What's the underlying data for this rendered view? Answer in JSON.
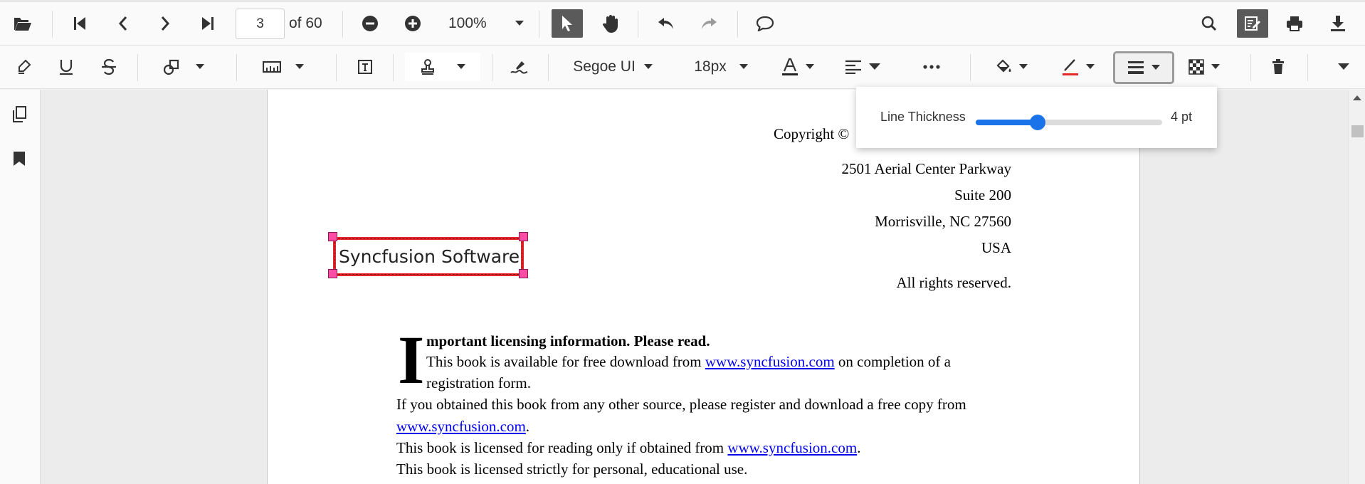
{
  "toolbar_top": {
    "current_page": "3",
    "page_count_label": "of 60",
    "zoom_value": "100%",
    "icons": [
      "folder-open-icon",
      "first-page-icon",
      "previous-page-icon",
      "next-page-icon",
      "last-page-icon",
      "zoom-out-icon",
      "zoom-in-icon",
      "chevron-down-icon",
      "pointer-icon",
      "pan-hand-icon",
      "undo-icon",
      "redo-icon",
      "comment-icon",
      "search-icon",
      "edit-annotation-icon",
      "print-icon",
      "download-icon"
    ]
  },
  "toolbar_annotation": {
    "font_family": "Segoe UI",
    "font_size": "18px",
    "icons": [
      "highlight-icon",
      "underline-icon",
      "strikethrough-icon",
      "shape-icon",
      "measure-icon",
      "free-text-icon",
      "stamp-icon",
      "signature-icon",
      "font-color-icon",
      "text-align-icon",
      "more-options-icon",
      "fill-color-icon",
      "stroke-color-icon",
      "line-thickness-icon",
      "opacity-icon",
      "delete-icon",
      "toolbar-collapse-icon"
    ]
  },
  "sidebar": {
    "icons": [
      "page-thumbnails-icon",
      "bookmarks-icon"
    ]
  },
  "line_thickness_popup": {
    "label": "Line Thickness",
    "value_label": "4 pt",
    "value": 4,
    "min": 0,
    "max": 12
  },
  "annotation": {
    "text": "Syncfusion Software",
    "stroke_color": "#e4262b"
  },
  "document": {
    "copyright": "Copyright ©",
    "address_lines": [
      "2501 Aerial Center Parkway",
      "Suite 200",
      "Morrisville, NC 27560",
      "USA"
    ],
    "rights": "All rights reserved.",
    "dropcap": "I",
    "heading_rest": "mportant licensing information. Please read.",
    "p1_a": "This book is available for free download from",
    "p1_link": "www.syncfusion.com",
    "p1_b": "on completion of a",
    "p1_c": "registration form.",
    "p2_a": "If you obtained this book from any other source, please register and download a free copy from",
    "p2_link": "www.syncfusion.com",
    "p2_b": ".",
    "p3_a": "This book is licensed for reading only if obtained from",
    "p3_link": "www.syncfusion.com",
    "p3_b": ".",
    "p4": "This book is licensed strictly for personal, educational use."
  },
  "colors": {
    "accent": "#1a73e8",
    "active_tool": "#5a5a5a",
    "link": "#0000ee",
    "annotation_handle": "#ff4da6"
  }
}
